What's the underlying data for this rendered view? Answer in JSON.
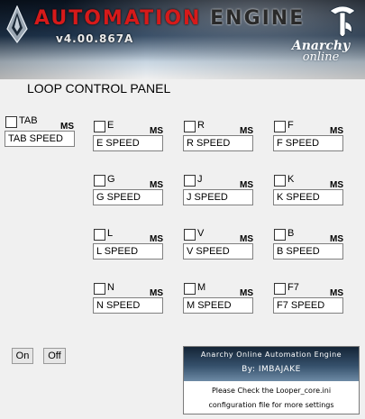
{
  "header": {
    "title_word1": "AUTOMATION",
    "title_word2": "ENGINE",
    "version": "v4.00.867A",
    "brand_line1": "Anarchy",
    "brand_line2": "online"
  },
  "panel_title": "LOOP CONTROL PANEL",
  "keys": [
    {
      "key": "TAB",
      "ms": "MS",
      "speed": "TAB SPEED",
      "checked": false
    },
    {
      "key": "E",
      "ms": "MS",
      "speed": "E SPEED",
      "checked": false
    },
    {
      "key": "R",
      "ms": "MS",
      "speed": "R SPEED",
      "checked": false
    },
    {
      "key": "F",
      "ms": "MS",
      "speed": "F SPEED",
      "checked": false
    },
    {
      "key": "G",
      "ms": "MS",
      "speed": "G SPEED",
      "checked": false
    },
    {
      "key": "J",
      "ms": "MS",
      "speed": "J SPEED",
      "checked": false
    },
    {
      "key": "K",
      "ms": "MS",
      "speed": "K SPEED",
      "checked": false
    },
    {
      "key": "L",
      "ms": "MS",
      "speed": "L SPEED",
      "checked": false
    },
    {
      "key": "V",
      "ms": "MS",
      "speed": "V SPEED",
      "checked": false
    },
    {
      "key": "B",
      "ms": "MS",
      "speed": "B SPEED",
      "checked": false
    },
    {
      "key": "N",
      "ms": "MS",
      "speed": "N SPEED",
      "checked": false
    },
    {
      "key": "M",
      "ms": "MS",
      "speed": "M SPEED",
      "checked": false
    },
    {
      "key": "F7",
      "ms": "MS",
      "speed": "F7 SPEED",
      "checked": false
    }
  ],
  "buttons": {
    "on": "On",
    "off": "Off"
  },
  "info": {
    "heading": "Anarchy Online Automation Engine",
    "author": "By: IMBAJAKE",
    "note_line1": "Please Check the Looper_core.ini",
    "note_line2": "configuration file for more settings"
  },
  "colors": {
    "title_red": "#d61a1a",
    "banner_dark": "#0a1320",
    "window_bg": "#f0f0f0"
  },
  "icons": {
    "left_logo": "ao-crest-icon",
    "right_logo": "ao-emblem-icon"
  }
}
